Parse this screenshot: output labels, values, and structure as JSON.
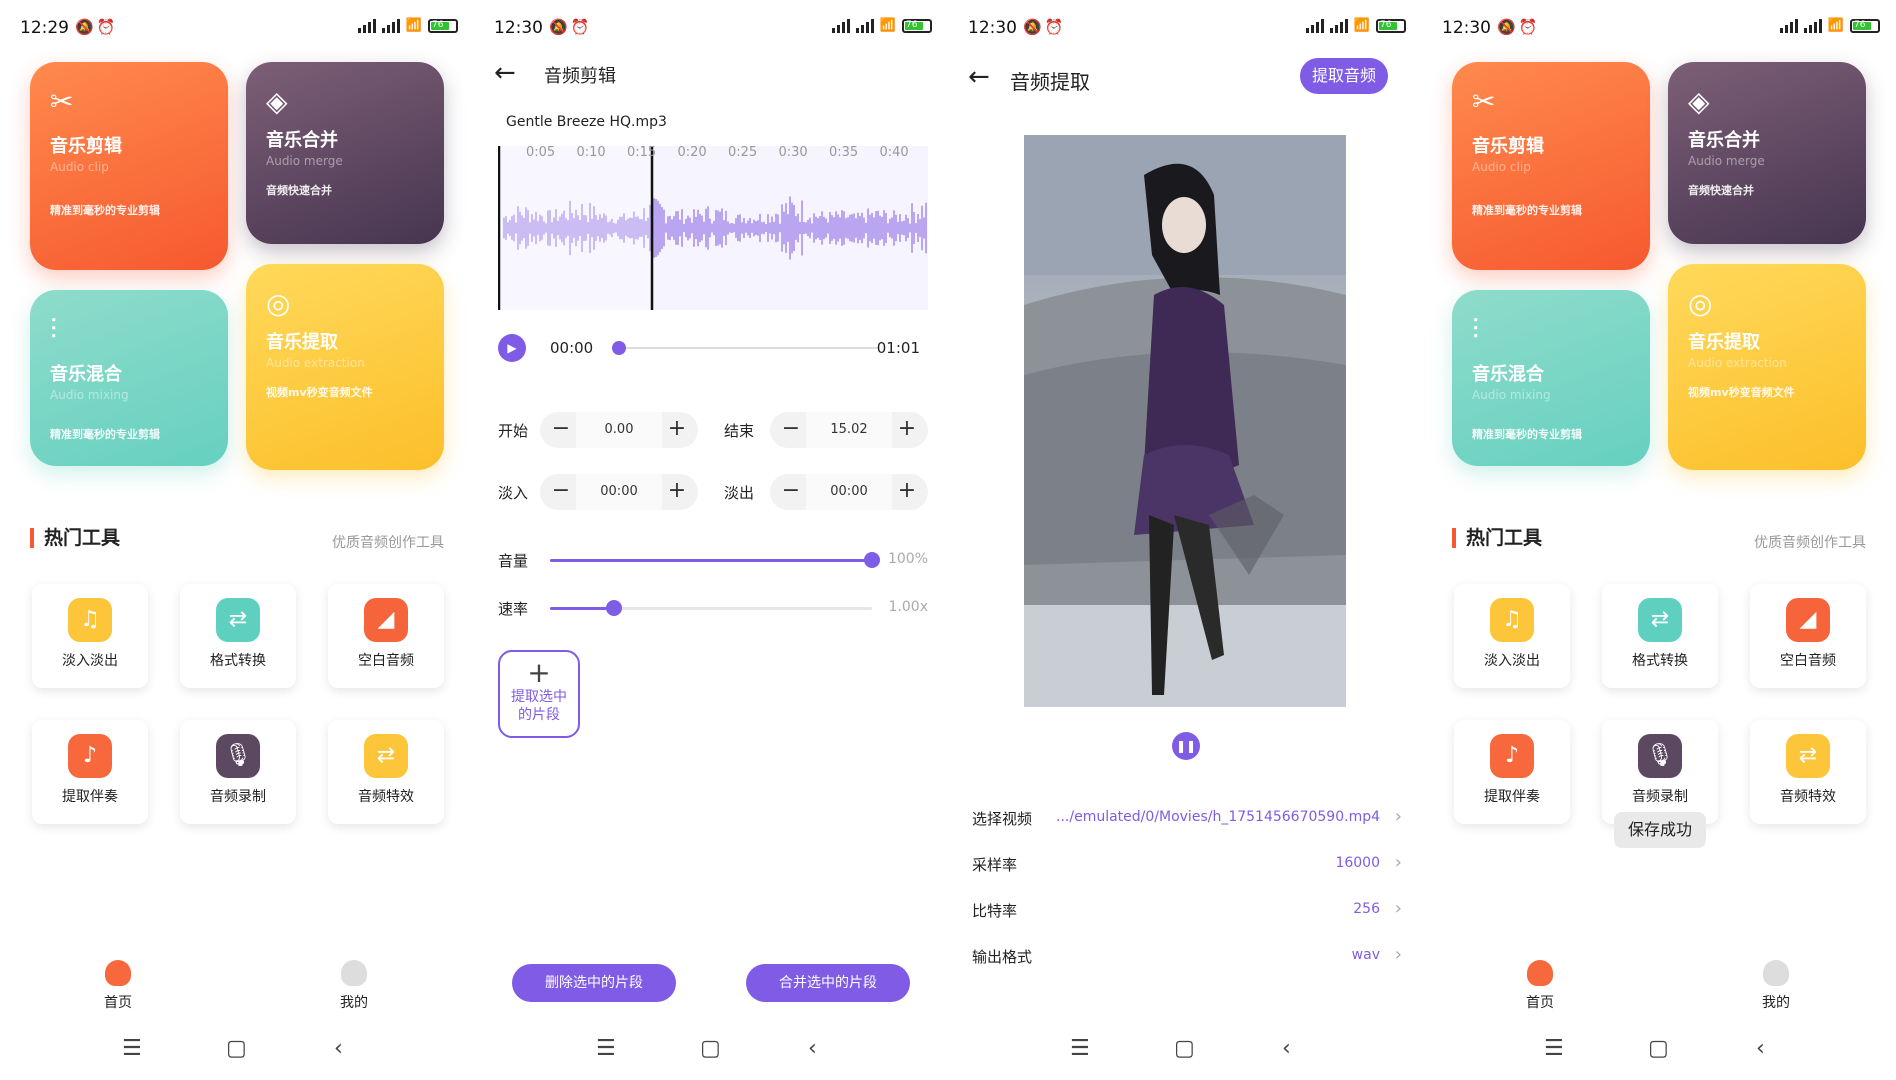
{
  "status": {
    "s1_time": "12:29",
    "s2_time": "12:30",
    "s3_time": "12:30",
    "s4_time": "12:30",
    "battery": "76"
  },
  "home": {
    "cards": [
      {
        "title": "音乐剪辑",
        "subtitle": "Audio clip",
        "desc": "精准到毫秒的专业剪辑",
        "icon": "scissors-icon"
      },
      {
        "title": "音乐合并",
        "subtitle": "Audio merge",
        "desc": "音频快速合并",
        "icon": "merge-icon"
      },
      {
        "title": "音乐混合",
        "subtitle": "Audio mixing",
        "desc": "精准到毫秒的专业剪辑",
        "icon": "sliders-icon"
      },
      {
        "title": "音乐提取",
        "subtitle": "Audio extraction",
        "desc": "视频mv秒变音频文件",
        "icon": "wave-icon"
      }
    ],
    "hot_title": "热门工具",
    "hot_subtitle": "优质音频创作工具",
    "tools": [
      {
        "label": "淡入淡出",
        "color": "#fcc53a",
        "icon": "fade-icon"
      },
      {
        "label": "格式转换",
        "color": "#5fd0c0",
        "icon": "convert-icon"
      },
      {
        "label": "空白音频",
        "color": "#f5643a",
        "icon": "blank-audio-icon"
      },
      {
        "label": "提取伴奏",
        "color": "#f7693d",
        "icon": "music-note-icon"
      },
      {
        "label": "音频录制",
        "color": "#5c4860",
        "icon": "microphone-icon"
      },
      {
        "label": "音频特效",
        "color": "#fcc53a",
        "icon": "effect-icon"
      }
    ],
    "tabs": {
      "home": "首页",
      "mine": "我的"
    },
    "toast": "保存成功"
  },
  "clip": {
    "title": "音频剪辑",
    "filename": "Gentle Breeze HQ.mp3",
    "ticks": [
      "0:05",
      "0:10",
      "0:15",
      "0:20",
      "0:25",
      "0:30",
      "0:35",
      "0:40"
    ],
    "current_time": "00:00",
    "total_time": "01:01",
    "start_label": "开始",
    "start_value": "0.00",
    "end_label": "结束",
    "end_value": "15.02",
    "fadein_label": "淡入",
    "fadein_value": "00:00",
    "fadeout_label": "淡出",
    "fadeout_value": "00:00",
    "volume_label": "音量",
    "volume_value": "100%",
    "volume_fraction": 1.0,
    "speed_label": "速率",
    "speed_value": "1.00x",
    "speed_fraction": 0.2,
    "extract_button": "提取选中的片段",
    "delete_button": "删除选中的片段",
    "merge_button": "合并选中的片段",
    "accent": "#7f5be6"
  },
  "extract": {
    "title": "音频提取",
    "action_button": "提取音频",
    "rows": [
      {
        "label": "选择视频",
        "value": ".../emulated/0/Movies/h_1751456670590.mp4"
      },
      {
        "label": "采样率",
        "value": "16000"
      },
      {
        "label": "比特率",
        "value": "256"
      },
      {
        "label": "输出格式",
        "value": "wav"
      }
    ]
  }
}
